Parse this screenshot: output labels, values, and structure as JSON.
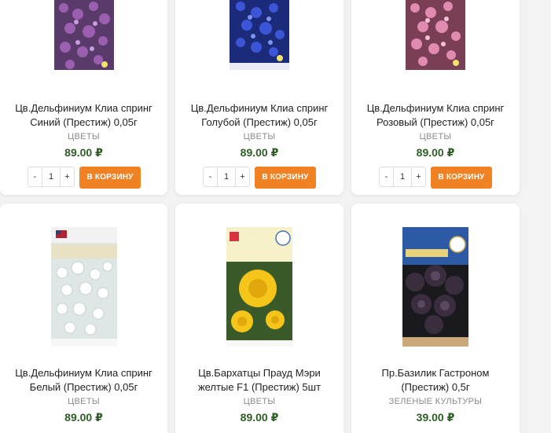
{
  "currency_colors": {
    "price": "#2e5e25",
    "accent": "#f08224"
  },
  "products": [
    {
      "title": "Цв.Дельфиниум Клиа спринг Синий (Престиж) 0,05г",
      "category": "ЦВЕТЫ",
      "price": "89.00 ₽",
      "qty": "1",
      "cart_label": "В КОРЗИНУ",
      "minus": "-",
      "plus": "+"
    },
    {
      "title": "Цв.Дельфиниум Клиа спринг Голубой (Престиж) 0,05г",
      "category": "ЦВЕТЫ",
      "price": "89.00 ₽",
      "qty": "1",
      "cart_label": "В КОРЗИНУ",
      "minus": "-",
      "plus": "+"
    },
    {
      "title": "Цв.Дельфиниум Клиа спринг Розовый (Престиж) 0,05г",
      "category": "ЦВЕТЫ",
      "price": "89.00 ₽",
      "qty": "1",
      "cart_label": "В КОРЗИНУ",
      "minus": "-",
      "plus": "+"
    },
    {
      "title": "Цв.Дельфиниум Клиа спринг Белый (Престиж) 0,05г",
      "category": "ЦВЕТЫ",
      "price": "89.00 ₽"
    },
    {
      "title": "Цв.Бархатцы Прауд Мэри желтые F1 (Престиж) 5шт",
      "category": "ЦВЕТЫ",
      "price": "89.00 ₽"
    },
    {
      "title": "Пр.Базилик Гастроном (Престиж) 0,5г",
      "category": "ЗЕЛЕНЫЕ КУЛЬТУРЫ",
      "price": "39.00 ₽"
    }
  ]
}
